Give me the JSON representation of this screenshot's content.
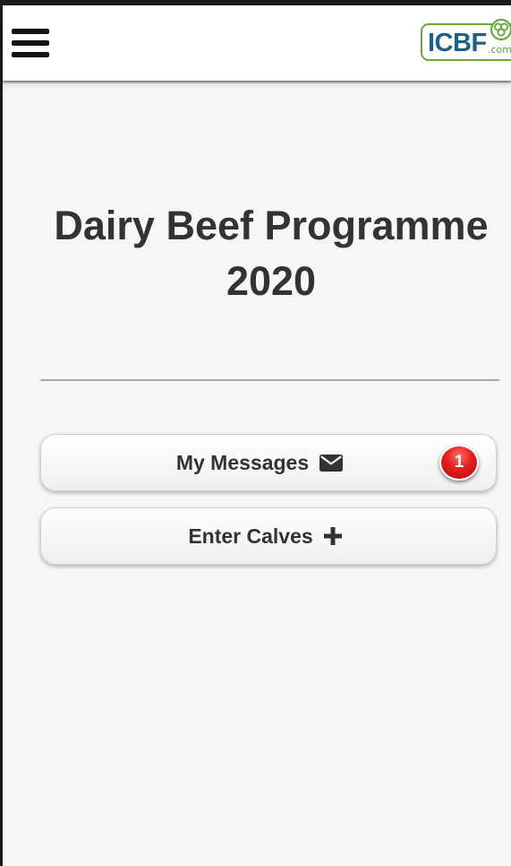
{
  "header": {
    "menu_icon": "hamburger-menu-icon",
    "logo": {
      "text": "ICBF",
      "suffix": ".com",
      "emblem_icon": "clover-icon",
      "colors": {
        "text": "#1c5f87",
        "accent": "#6aa842"
      }
    }
  },
  "main": {
    "title": "Dairy Beef Programme 2020",
    "buttons": [
      {
        "label": "My Messages",
        "icon": "envelope-icon",
        "badge": "1"
      },
      {
        "label": "Enter Calves",
        "icon": "plus-icon"
      }
    ]
  },
  "colors": {
    "background": "#f6f6f6",
    "text": "#333333",
    "badge": "#e41e1e",
    "divider": "#a9a9a9"
  }
}
